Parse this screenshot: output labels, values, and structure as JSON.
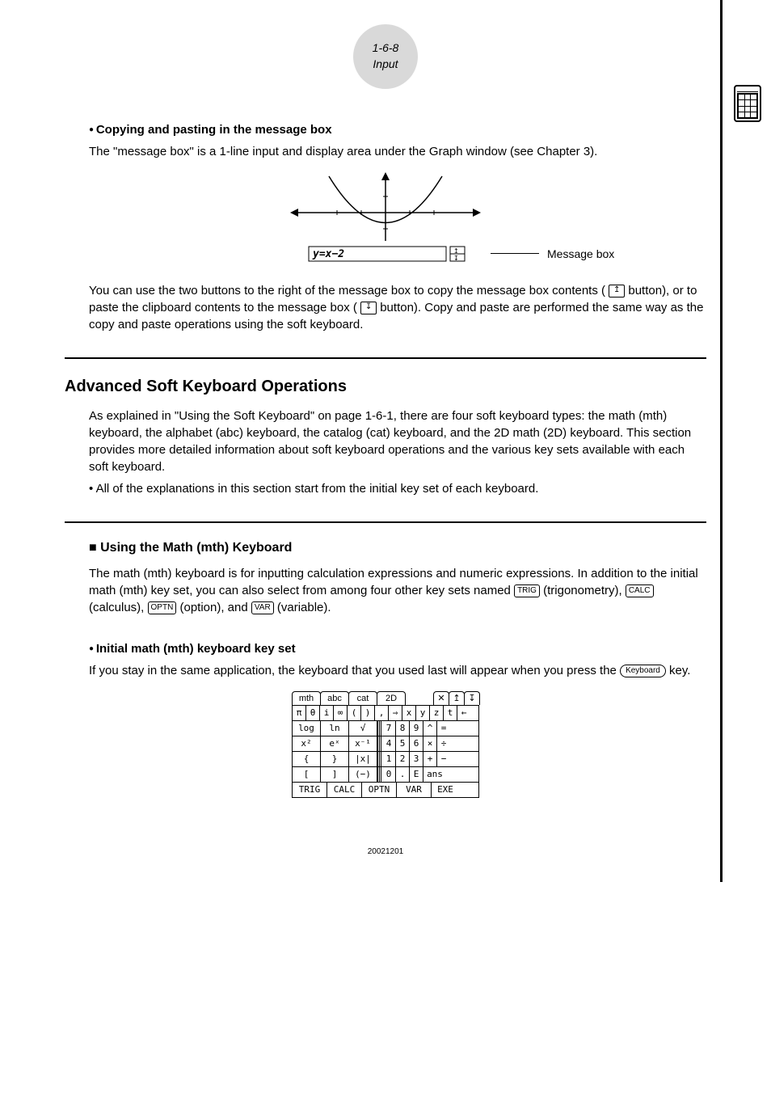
{
  "header": {
    "page_ref": "1-6-8",
    "page_title": "Input"
  },
  "side_icon": "calculator-icon",
  "sec1": {
    "bullet_title": "Copying and pasting in the message box",
    "p1": "The \"message box\" is a 1-line input and display area under the Graph window (see Chapter 3).",
    "figure_label": "Message box",
    "figure_formula": "y=x−2",
    "p2a": "You can use the two buttons to the right of the message box to copy the message box contents (",
    "p2b": " button), or to paste the clipboard contents to the message box (",
    "p2c": " button). Copy and paste are performed the same way as the copy and paste operations using the soft keyboard."
  },
  "sec2": {
    "title": "Advanced Soft Keyboard Operations",
    "p1": "As explained in \"Using the Soft Keyboard\" on page 1-6-1, there are four soft keyboard types: the math (mth) keyboard, the alphabet (abc) keyboard, the catalog (cat) keyboard, and the 2D math (2D) keyboard.  This section provides more detailed information about soft keyboard operations and the various key sets available with each soft keyboard.",
    "p2": "• All of the explanations in this section start from the initial key set of each keyboard."
  },
  "sec3": {
    "title": "Using the Math (mth) Keyboard",
    "p1a": "The math (mth) keyboard is for inputting calculation expressions and numeric expressions. In addition to the initial math (mth) key set, you can also select from among four other key sets named ",
    "k1": "TRIG",
    "t1": " (trigonometry), ",
    "k2": "CALC",
    "t2": " (calculus), ",
    "k3": "OPTN",
    "t3": " (option), and ",
    "k4": "VAR",
    "t4": " (variable).",
    "bullet_title": "Initial math (mth) keyboard key set",
    "p2a": "If you stay in the same application, the keyboard that you used last will appear when you press the ",
    "p2key": "Keyboard",
    "p2b": " key."
  },
  "keyboard": {
    "tabs": [
      "mth",
      "abc",
      "cat",
      "2D"
    ],
    "tab_icons": [
      "✕",
      "↥",
      "↧"
    ],
    "row1": [
      "π",
      "θ",
      "i",
      "∞",
      "(",
      ")",
      ",",
      "⇒",
      "x",
      "y",
      "z",
      "t",
      "←"
    ],
    "row2l": [
      "log",
      "ln",
      "√"
    ],
    "row2r": [
      "7",
      "8",
      "9",
      "^",
      "="
    ],
    "row3l": [
      "x²",
      "eˣ",
      "x⁻¹"
    ],
    "row3r": [
      "4",
      "5",
      "6",
      "×",
      "÷"
    ],
    "row4l": [
      "{",
      "}",
      "|x|"
    ],
    "row4r": [
      "1",
      "2",
      "3",
      "+",
      "−"
    ],
    "row5l": [
      "[",
      "]",
      "(−)"
    ],
    "row5r": [
      "0",
      ".",
      "E",
      "ans"
    ],
    "row6": [
      "TRIG",
      "CALC",
      "OPTN",
      "VAR",
      "EXE"
    ]
  },
  "footer": {
    "doc_date": "20021201"
  }
}
